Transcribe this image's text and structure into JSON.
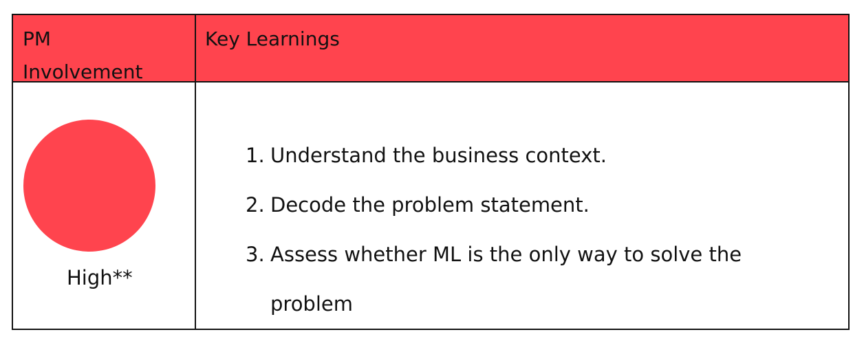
{
  "table": {
    "header": {
      "col1": [
        "PM",
        "Involvement"
      ],
      "col2": "Key Learnings"
    },
    "involvement": {
      "level_label": "High**",
      "indicator_color": "#ff444e"
    },
    "learnings": [
      {
        "num": "1.",
        "text": "Understand the business context."
      },
      {
        "num": "2.",
        "text": "Decode the problem statement."
      },
      {
        "num": "3.",
        "text": "Assess whether ML is the only way to solve the"
      },
      {
        "num": "",
        "text": "problem"
      }
    ]
  },
  "colors": {
    "header_bg": "#ff444e",
    "border": "#111111",
    "text": "#111111"
  }
}
